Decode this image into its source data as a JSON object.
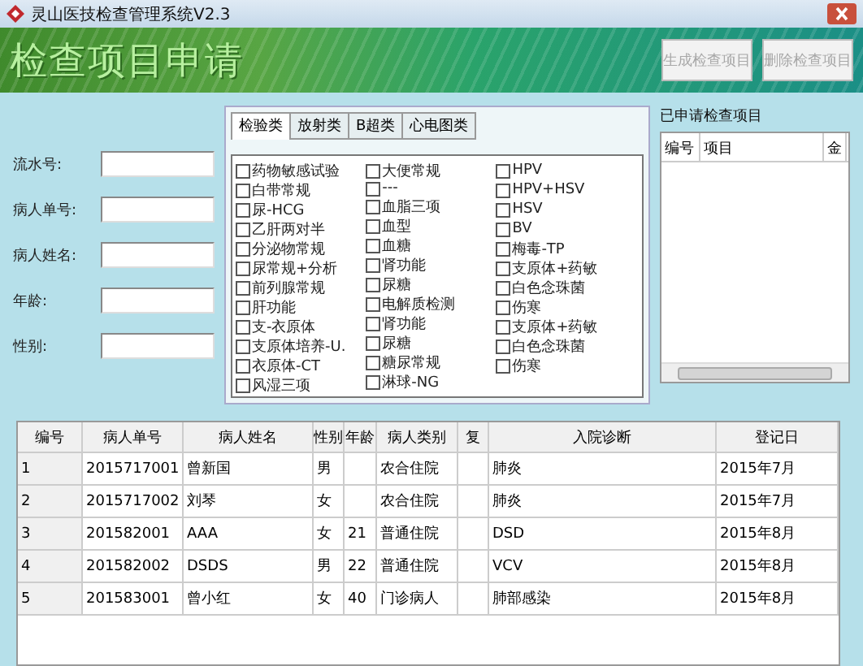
{
  "window": {
    "title": "灵山医技检查管理系统V2.3"
  },
  "banner": {
    "title": "检查项目申请",
    "buttons": [
      {
        "label": "生成检查项目",
        "disabled": true
      },
      {
        "label": "删除检查项目",
        "disabled": true
      }
    ]
  },
  "form": {
    "fields": [
      {
        "label": "流水号:"
      },
      {
        "label": "病人单号:"
      },
      {
        "label": "病人姓名:"
      },
      {
        "label": "年龄:"
      },
      {
        "label": "性别:"
      }
    ]
  },
  "tabs": [
    {
      "label": "检验类",
      "selected": true
    },
    {
      "label": "放射类",
      "selected": false
    },
    {
      "label": "B超类",
      "selected": false
    },
    {
      "label": "心电图类",
      "selected": false
    }
  ],
  "check_columns": [
    [
      {
        "label": "药物敏感试验",
        "checked": false
      },
      {
        "label": "白带常规",
        "checked": false
      },
      {
        "label": "尿-HCG",
        "checked": false
      },
      {
        "label": "乙肝两对半",
        "checked": false
      },
      {
        "label": "分泌物常规",
        "checked": false
      },
      {
        "label": "尿常规+分析",
        "checked": false
      },
      {
        "label": "前列腺常规",
        "checked": false
      },
      {
        "label": "肝功能",
        "checked": false
      },
      {
        "label": "支-衣原体",
        "checked": false
      },
      {
        "label": "支原体培养-U.",
        "checked": false
      },
      {
        "label": "衣原体-CT",
        "checked": false
      },
      {
        "label": "风湿三项",
        "checked": false
      }
    ],
    [
      {
        "label": "大便常规",
        "checked": false
      },
      {
        "label": "---",
        "checked": false
      },
      {
        "label": "血脂三项",
        "checked": false
      },
      {
        "label": "血型",
        "checked": false
      },
      {
        "label": "血糖",
        "checked": false
      },
      {
        "label": "肾功能",
        "checked": false
      },
      {
        "label": "尿糖",
        "checked": false
      },
      {
        "label": "电解质检测",
        "checked": false
      },
      {
        "label": "肾功能",
        "checked": false
      },
      {
        "label": "尿糖",
        "checked": false
      },
      {
        "label": "糖尿常规",
        "checked": false
      },
      {
        "label": "淋球-NG",
        "checked": false
      }
    ],
    [
      {
        "label": "HPV",
        "checked": false
      },
      {
        "label": "HPV+HSV",
        "checked": false
      },
      {
        "label": "HSV",
        "checked": false
      },
      {
        "label": "BV",
        "checked": false
      },
      {
        "label": "梅毒-TP",
        "checked": false
      },
      {
        "label": "支原体+药敏",
        "checked": false
      },
      {
        "label": "白色念珠菌",
        "checked": false
      },
      {
        "label": "伤寒",
        "checked": false
      },
      {
        "label": "支原体+药敏",
        "checked": false
      },
      {
        "label": "白色念珠菌",
        "checked": false
      },
      {
        "label": "伤寒",
        "checked": false
      }
    ]
  ],
  "applied": {
    "title": "已申请检查项目",
    "columns": [
      "编号",
      "项目",
      "金"
    ]
  },
  "table": {
    "columns": [
      "编号",
      "病人单号",
      "病人姓名",
      "性别",
      "年龄",
      "病人类别",
      "复",
      "入院诊断",
      "登记日"
    ],
    "rows": [
      [
        "1",
        "2015717001",
        "曾新国",
        "男",
        "",
        "农合住院",
        "",
        "肺炎",
        "2015年7月"
      ],
      [
        "2",
        "2015717002",
        "刘琴",
        "女",
        "",
        "农合住院",
        "",
        "肺炎",
        "2015年7月"
      ],
      [
        "3",
        "201582001",
        "AAA",
        "女",
        "21",
        "普通住院",
        "",
        "DSD",
        "2015年8月"
      ],
      [
        "4",
        "201582002",
        "DSDS",
        "男",
        "22",
        "普通住院",
        "",
        "VCV",
        "2015年8月"
      ],
      [
        "5",
        "201583001",
        "曾小红",
        "女",
        "40",
        "门诊病人",
        "",
        "肺部感染",
        "2015年8月"
      ]
    ]
  }
}
